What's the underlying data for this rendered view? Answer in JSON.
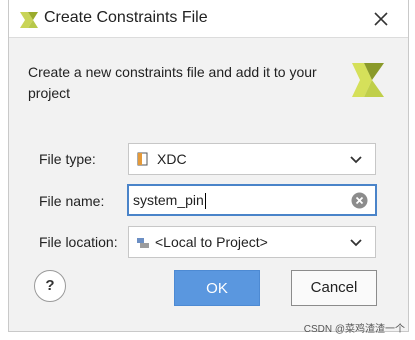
{
  "window": {
    "title": "Create Constraints File"
  },
  "description": "Create a new constraints file and add it to your project",
  "form": {
    "file_type": {
      "label": "File type:",
      "value": "XDC",
      "icon": "xdc-file-icon"
    },
    "file_name": {
      "label": "File name:",
      "value": "system_pin"
    },
    "file_location": {
      "label": "File location:",
      "value": "<Local to Project>",
      "icon": "project-location-icon"
    }
  },
  "buttons": {
    "help": "?",
    "ok": "OK",
    "cancel": "Cancel"
  },
  "watermark": "CSDN @菜鸡渣渣一个",
  "colors": {
    "accent": "#5a97df",
    "focus_border": "#4a84c9",
    "logo_light": "#d5e05a",
    "logo_dark": "#8a9a2a"
  }
}
